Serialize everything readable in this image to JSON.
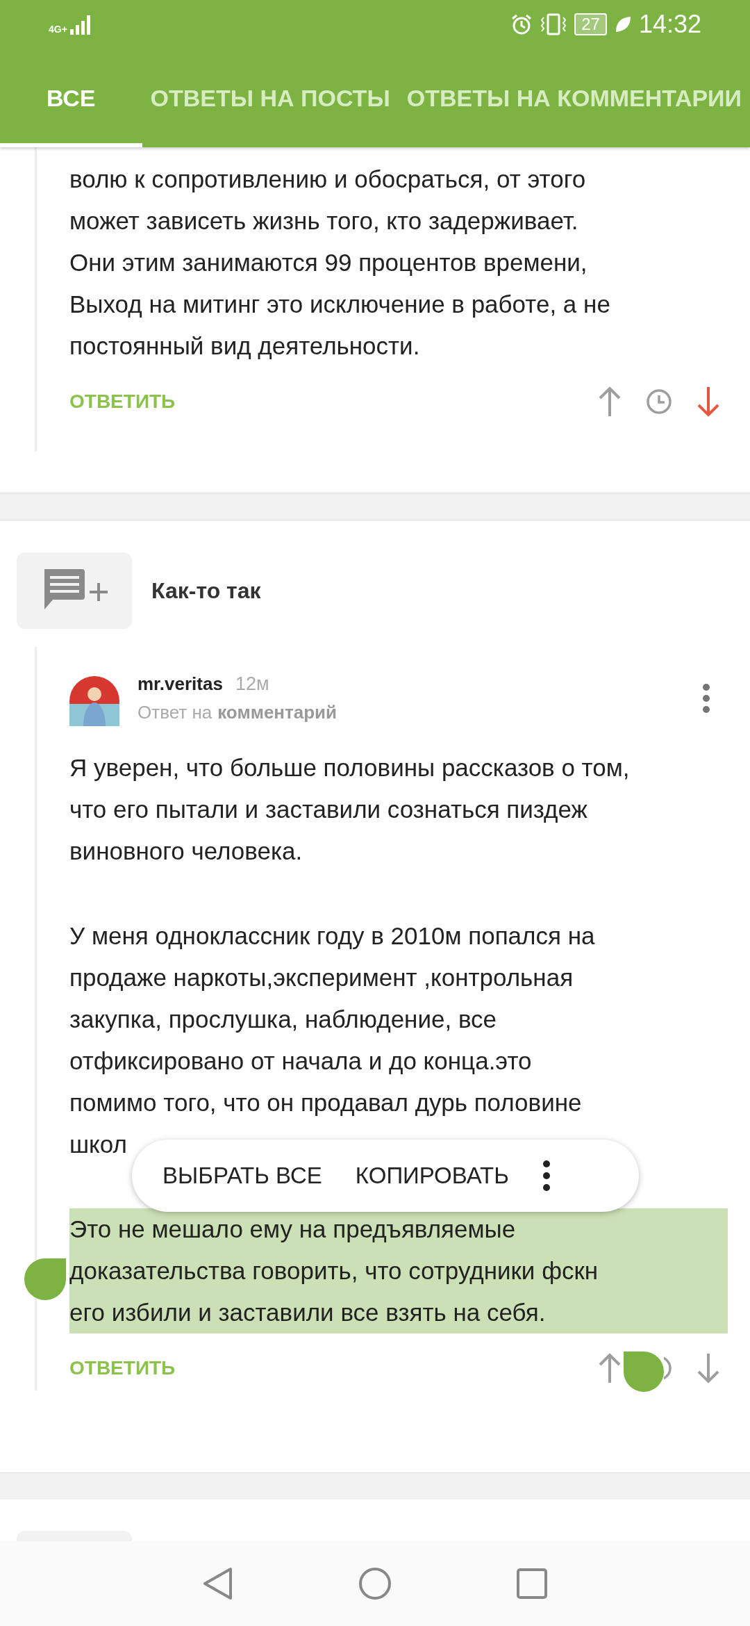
{
  "status_bar": {
    "network": "4G+",
    "battery": "27",
    "time": "14:32"
  },
  "tabs": [
    {
      "label": "ВСЕ",
      "selected": true
    },
    {
      "label": "ОТВЕТЫ НА ПОСТЫ",
      "selected": false
    },
    {
      "label": "ОТВЕТЫ НА КОММЕНТАРИИ",
      "selected": false
    }
  ],
  "first_comment": {
    "paragraphs": [
      {
        "selected": false,
        "lines": [
          "волю к сопротивлению и обосраться, от этого",
          "может зависеть жизнь того, кто задерживает.",
          "Они этим занимаются 99 процентов времени,",
          "Выход на митинг это исключение в работе, а не",
          "постоянный вид деятельности."
        ]
      }
    ],
    "reply": "ОТВЕТИТЬ",
    "upvoted": false,
    "downvoted": true
  },
  "story": {
    "title": "Как-то так"
  },
  "comment": {
    "author": "mr.veritas",
    "time": "12м",
    "reply_to_prefix": "Ответ на",
    "reply_to_link": "комментарий",
    "paragraphs": [
      {
        "selected": false,
        "lines": [
          "Я уверен, что больше половины рассказов о том,",
          "что его пытали и заставили сознаться пиздеж",
          "виновного человека."
        ]
      },
      {
        "selected": false,
        "lines": [
          "У меня одноклассник году в 2010м попался на",
          "продаже наркоты,эксперимент ,контрольная",
          "закупка, прослушка, наблюдение, все",
          "отфиксировано от начала и до конца.это",
          "помимо того, что он продавал дурь половине",
          "школ"
        ]
      },
      {
        "selected": true,
        "lines": [
          "Это не мешало ему на предъявляемые",
          "доказательства говорить, что сотрудники фскн",
          "его избили и заставили все взять на себя."
        ]
      }
    ],
    "reply": "ОТВЕТИТЬ",
    "upvoted": false,
    "downvoted": false
  },
  "selection_menu": {
    "items": [
      "ВЫБРАТЬ ВСЕ",
      "КОПИРОВАТЬ"
    ]
  }
}
